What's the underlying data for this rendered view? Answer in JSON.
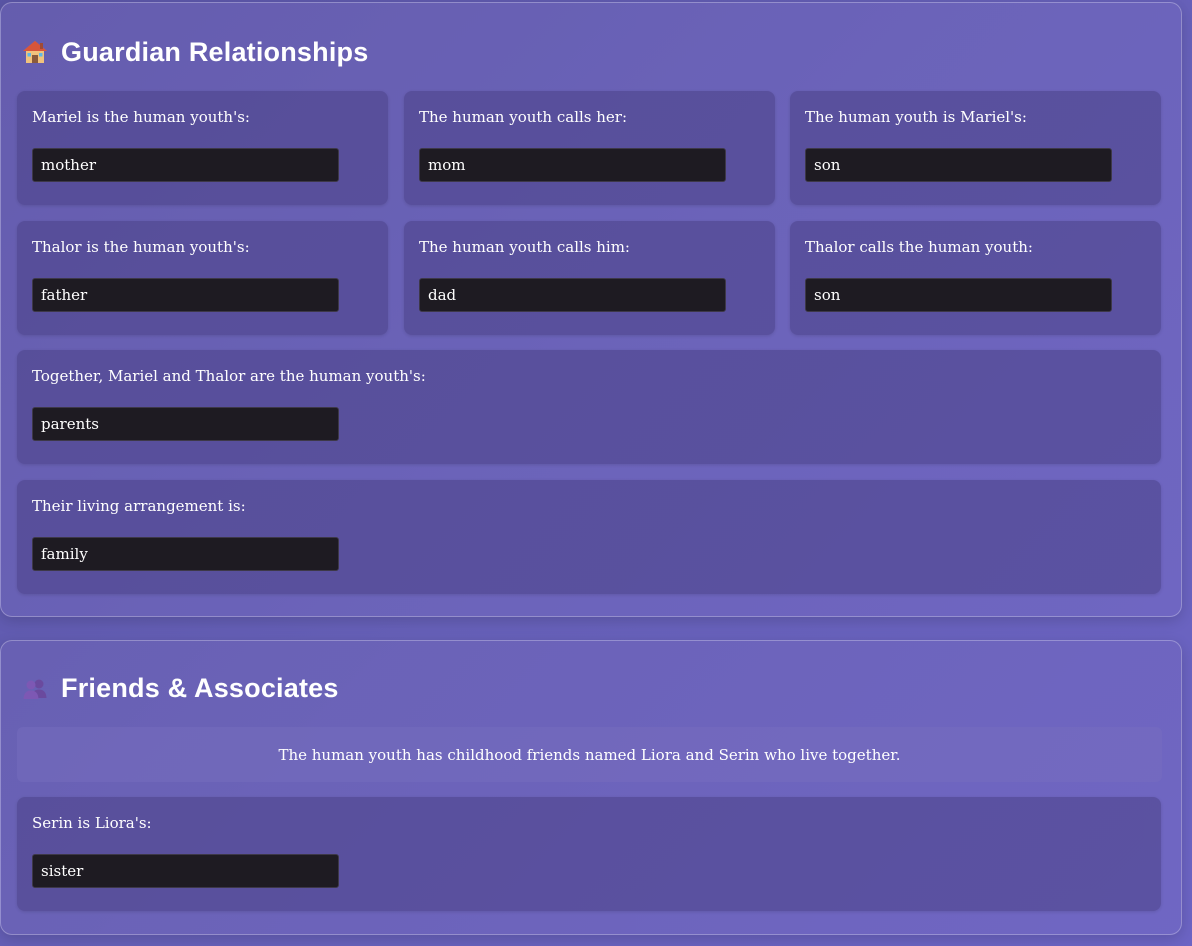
{
  "guardian": {
    "icon": "house-icon",
    "title": "Guardian Relationships",
    "cards": [
      {
        "label": "Mariel is the human youth's:",
        "value": "mother"
      },
      {
        "label": "The human youth calls her:",
        "value": "mom"
      },
      {
        "label": "The human youth is Mariel's:",
        "value": "son"
      },
      {
        "label": "Thalor is the human youth's:",
        "value": "father"
      },
      {
        "label": "The human youth calls him:",
        "value": "dad"
      },
      {
        "label": "Thalor calls the human youth:",
        "value": "son"
      },
      {
        "label": "Together, Mariel and Thalor are the human youth's:",
        "value": "parents"
      },
      {
        "label": "Their living arrangement is:",
        "value": "family"
      }
    ]
  },
  "friends": {
    "icon": "people-icon",
    "title": "Friends & Associates",
    "info": "The human youth has childhood friends named Liora and Serin who live together.",
    "cards": [
      {
        "label": "Serin is Liora's:",
        "value": "sister"
      }
    ]
  }
}
